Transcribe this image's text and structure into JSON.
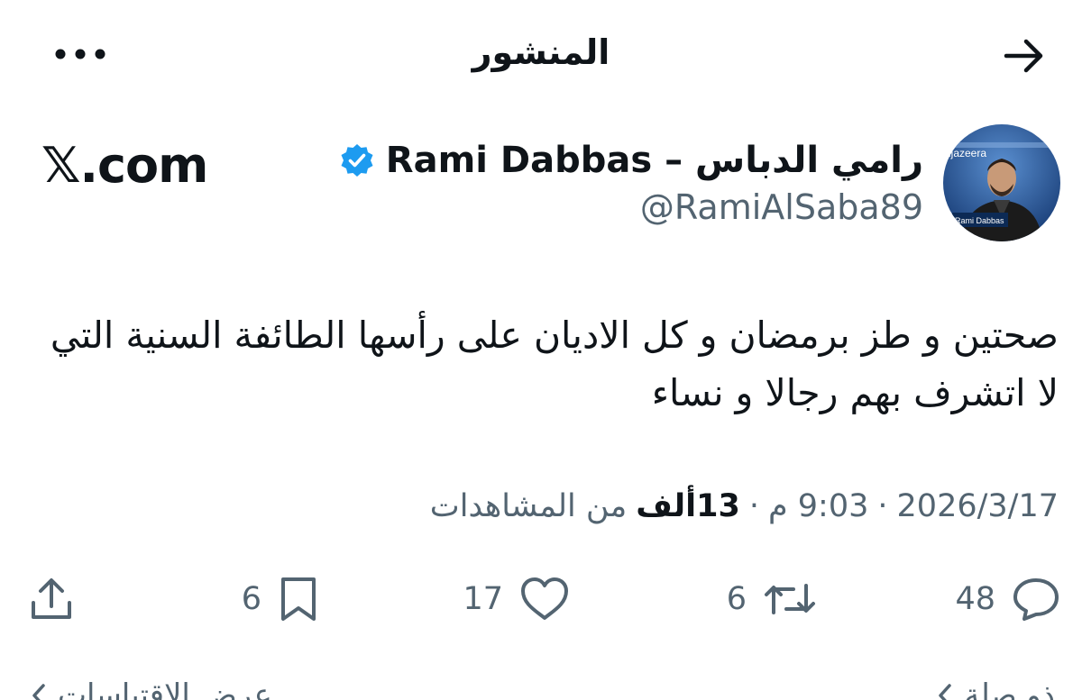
{
  "header": {
    "title": "المنشور",
    "back_icon": "arrow-right-icon",
    "more_icon": "more-horizontal-icon"
  },
  "brand": "𝕏.com",
  "author": {
    "name": "رامي الدباس – Rami Dabbas",
    "handle": "@RamiAlSaba89",
    "verified": true,
    "badge_color": "#1d9bf0",
    "avatar_caption": "Rami Dabbas",
    "avatar_channel": "ljazeera"
  },
  "post": {
    "text": "صحتين و طز برمضان و كل الاديان على رأسها الطائفة السنية التي لا اتشرف بهم رجالا و نساء"
  },
  "meta": {
    "date": "2026/3/17",
    "time": "9:03 م",
    "views_number": "13",
    "views_unit": "ألف",
    "views_label": "من المشاهدات",
    "separator": "·"
  },
  "actions": {
    "replies": "48",
    "reposts": "6",
    "likes": "17",
    "bookmarks": "6"
  },
  "bottom": {
    "right_label": "ذو صلة",
    "left_label": "عرض الاقتباسات"
  }
}
